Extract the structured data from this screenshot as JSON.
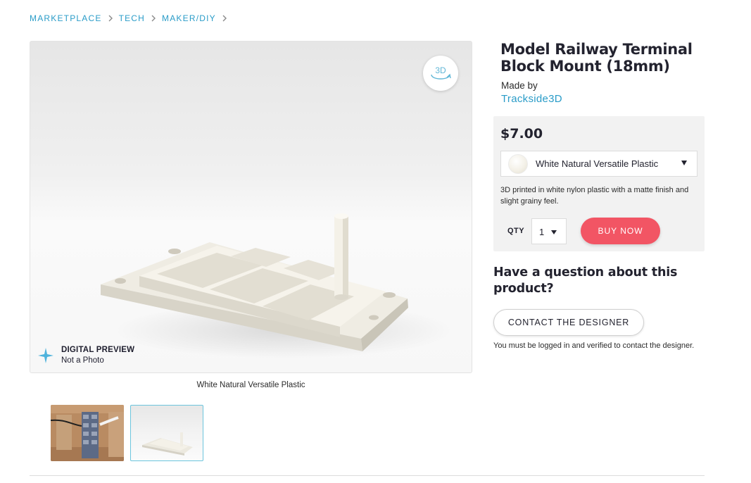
{
  "breadcrumb": {
    "items": [
      "MARKETPLACE",
      "TECH",
      "MAKER/DIY"
    ],
    "separator_icon": "chevron-right-icon"
  },
  "viewer": {
    "view_3d_label": "3D",
    "view_3d_icon": "rotate-3d-icon",
    "preview_icon": "sparkle-icon",
    "preview_title": "DIGITAL PREVIEW",
    "preview_subtitle": "Not a Photo",
    "caption": "White Natural Versatile Plastic"
  },
  "thumbnails": [
    {
      "name": "photo-thumbnail",
      "selected": false
    },
    {
      "name": "digital-preview-thumbnail",
      "selected": true
    }
  ],
  "product": {
    "title": "Model Railway Terminal Block Mount (18mm)",
    "made_by_label": "Made by",
    "designer": "Trackside3D"
  },
  "purchase": {
    "price": "$7.00",
    "material": "White Natural Versatile Plastic",
    "material_description": "3D printed in white nylon plastic with a matte finish and slight grainy feel.",
    "qty_label": "QTY",
    "qty_value": "1",
    "buy_label": "BUY NOW",
    "buy_color": "#f25564"
  },
  "question": {
    "heading": "Have a question about this product?",
    "contact_label": "CONTACT THE DESIGNER",
    "note": "You must be logged in and verified to contact the designer."
  },
  "colors": {
    "link": "#2a9cc8",
    "accent": "#f25564",
    "panel": "#f2f2f2"
  }
}
